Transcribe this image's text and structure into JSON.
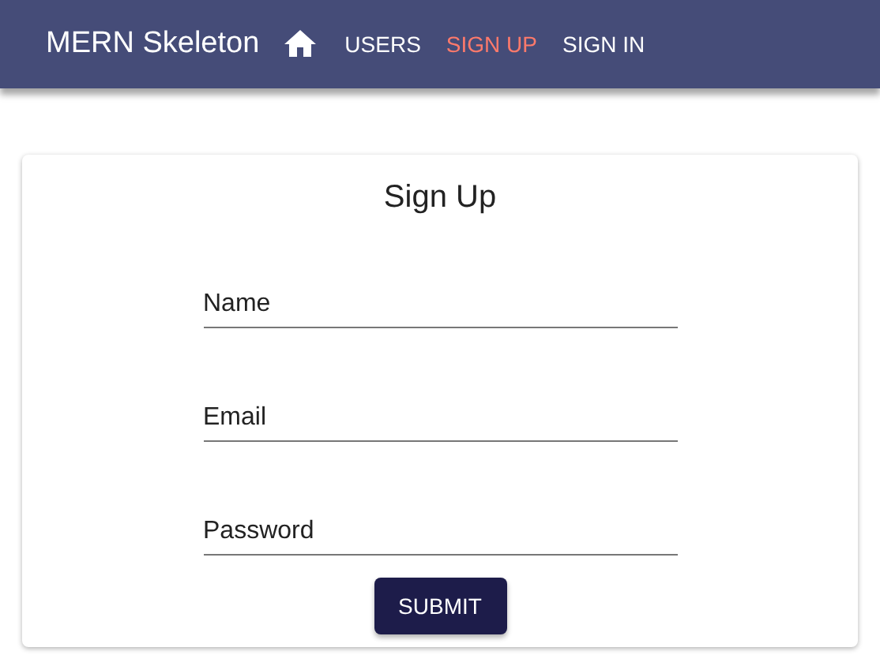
{
  "app_bar": {
    "title": "MERN Skeleton",
    "nav": [
      {
        "label": "USERS",
        "selected": false
      },
      {
        "label": "SIGN UP",
        "selected": true
      },
      {
        "label": "SIGN IN",
        "selected": false
      }
    ]
  },
  "card": {
    "title": "Sign Up",
    "fields": [
      {
        "placeholder": "Name"
      },
      {
        "placeholder": "Email"
      },
      {
        "placeholder": "Password"
      }
    ],
    "submit": "SUBMIT"
  }
}
